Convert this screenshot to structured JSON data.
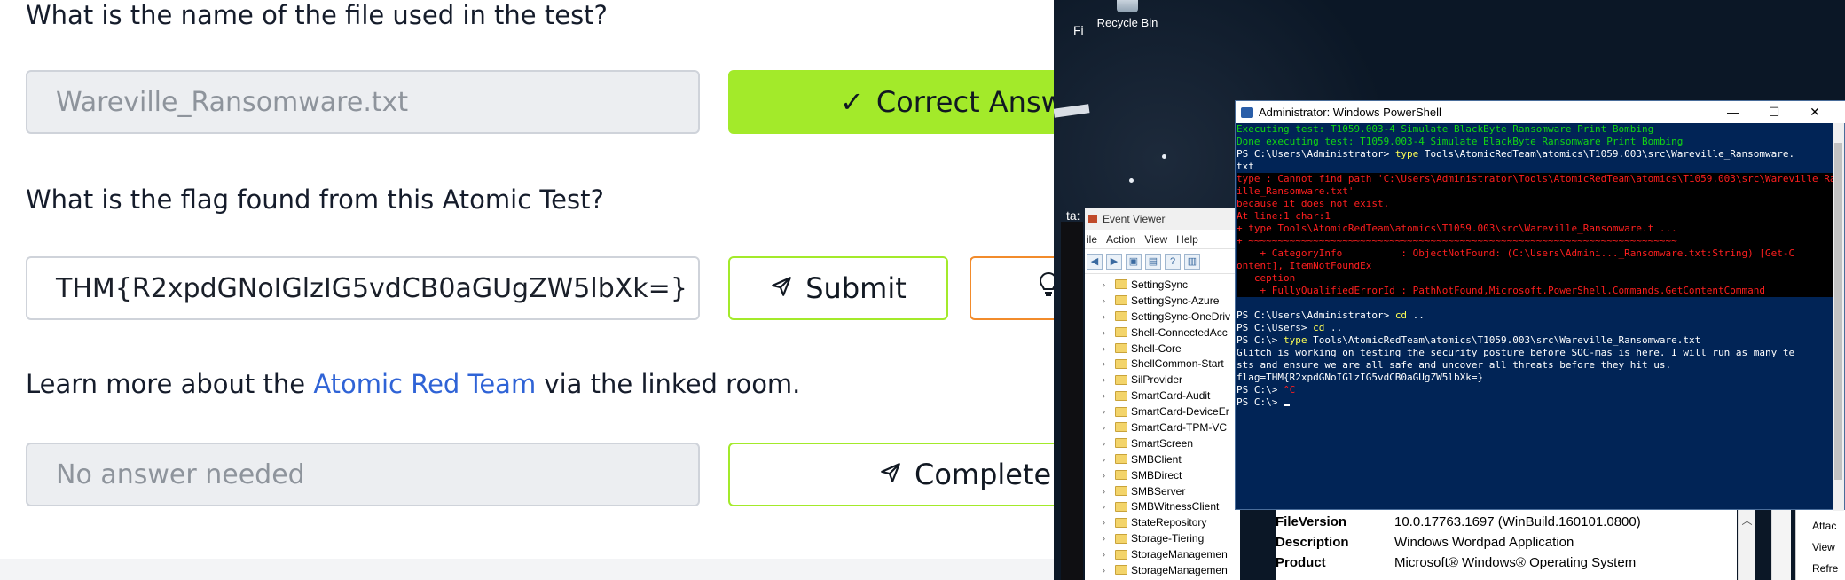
{
  "quiz": {
    "q1": {
      "question": "What is the name of the file used in the test?",
      "answer": "Wareville_Ransomware.txt",
      "button": "Correct Answer"
    },
    "q2": {
      "question": "What is the flag found from this Atomic Test?",
      "answer": "THM{R2xpdGNoIGlzIG5vdCB0aGUgZW5lbXk=}",
      "submit": "Submit",
      "hint": "Hint"
    },
    "q3": {
      "text_before": "Learn more about the ",
      "link": "Atomic Red Team",
      "text_after": " via the linked room.",
      "placeholder": "No answer needed",
      "button": "Complete"
    }
  },
  "desktop": {
    "recycle_bin": "Recycle Bin",
    "frag_fi": "Fi",
    "frag_ta": "ta:"
  },
  "event_viewer": {
    "title": "Event Viewer",
    "menu": [
      "ile",
      "Action",
      "View",
      "Help"
    ],
    "tree": [
      "SettingSync",
      "SettingSync-Azure",
      "SettingSync-OneDriv",
      "Shell-ConnectedAcc",
      "Shell-Core",
      "ShellCommon-Start",
      "SilProvider",
      "SmartCard-Audit",
      "SmartCard-DeviceEr",
      "SmartCard-TPM-VC",
      "SmartScreen",
      "SMBClient",
      "SMBDirect",
      "SMBServer",
      "SMBWitnessClient",
      "StateRepository",
      "Storage-Tiering",
      "StorageManagemen",
      "StorageManagemen"
    ]
  },
  "properties": {
    "rows": [
      {
        "key": "FileVersion",
        "value": "10.0.17763.1697 (WinBuild.160101.0800)"
      },
      {
        "key": "Description",
        "value": "Windows Wordpad Application"
      },
      {
        "key": "Product",
        "value": "Microsoft® Windows® Operating System"
      }
    ],
    "right_items": [
      "Attac",
      "View",
      "Refre"
    ]
  },
  "powershell": {
    "title": "Administrator: Windows PowerShell",
    "lines": [
      {
        "cls": "green",
        "text": "Executing test: T1059.003-4 Simulate BlackByte Ransomware Print Bombing"
      },
      {
        "cls": "green",
        "text": "Done executing test: T1059.003-4 Simulate BlackByte Ransomware Print Bombing"
      },
      {
        "cls": "cmd",
        "prompt": "PS C:\\Users\\Administrator> ",
        "cmd": "type",
        "rest": " Tools\\AtomicRedTeam\\atomics\\T1059.003\\src\\Wareville_Ransomware."
      },
      {
        "cls": "white",
        "text": "txt"
      },
      {
        "cls": "red errblk",
        "text": "type : Cannot find path 'C:\\Users\\Administrator\\Tools\\AtomicRedTeam\\atomics\\T1059.003\\src\\Wareville_Ransomware.txt'"
      },
      {
        "cls": "red errblk",
        "text": "ille_Ransomware.txt'"
      },
      {
        "cls": "red errblk",
        "text": "because it does not exist."
      },
      {
        "cls": "red errblk",
        "text": "At line:1 char:1"
      },
      {
        "cls": "red errblk",
        "text": "+ type Tools\\AtomicRedTeam\\atomics\\T1059.003\\src\\Wareville_Ransomware.t ..."
      },
      {
        "cls": "red errblk",
        "text": "+ ~~~~~~~~~~~~~~~~~~~~~~~~~~~~~~~~~~~~~~~~~~~~~~~~~~~~~~~~~~~~~~~~~~~~~~~~~"
      },
      {
        "cls": "red errblk",
        "text": "    + CategoryInfo          : ObjectNotFound: (C:\\Users\\Admini..._Ransomware.txt:String) [Get-C"
      },
      {
        "cls": "red errblk",
        "text": "ontent], ItemNotFoundEx"
      },
      {
        "cls": "red errblk",
        "text": "   ception"
      },
      {
        "cls": "red errblk",
        "text": "    + FullyQualifiedErrorId : PathNotFound,Microsoft.PowerShell.Commands.GetContentCommand"
      },
      {
        "cls": "white",
        "text": " "
      },
      {
        "cls": "cmd",
        "prompt": "PS C:\\Users\\Administrator> ",
        "cmd": "cd",
        "rest": " .."
      },
      {
        "cls": "cmd",
        "prompt": "PS C:\\Users> ",
        "cmd": "cd",
        "rest": " .."
      },
      {
        "cls": "cmd",
        "prompt": "PS C:\\> ",
        "cmd": "type",
        "rest": " Tools\\AtomicRedTeam\\atomics\\T1059.003\\src\\Wareville_Ransomware.txt"
      },
      {
        "cls": "white",
        "text": "Glitch is working on testing the security posture before SOC-mas is here. I will run as many te"
      },
      {
        "cls": "white",
        "text": "sts and ensure we are all safe and uncover all threats before they hit us."
      },
      {
        "cls": "white",
        "text": "flag=THM{R2xpdGNoIGlzIG5vdCB0aGUgZW5lbXk=}"
      },
      {
        "cls": "ctrlc",
        "prompt": "PS C:\\> ",
        "cmd": "^C",
        "rest": ""
      },
      {
        "cls": "last",
        "prompt": "PS C:\\> ",
        "cmd": "",
        "rest": ""
      }
    ]
  }
}
